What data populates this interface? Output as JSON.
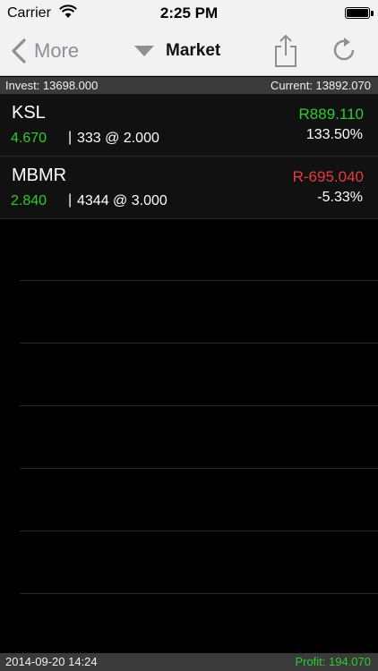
{
  "status_bar": {
    "carrier": "Carrier",
    "time": "2:25 PM",
    "wifi_icon": "wifi-icon",
    "battery_icon": "battery-icon"
  },
  "nav": {
    "back_label": "More",
    "back_icon": "chevron-left-icon",
    "market_label": "Market",
    "market_icon": "triangle-down-icon",
    "share_icon": "share-icon",
    "refresh_icon": "refresh-icon"
  },
  "summary": {
    "invest": "Invest: 13698.000",
    "current": "Current: 13892.070"
  },
  "holdings": [
    {
      "symbol": "KSL",
      "price": "4.670",
      "separator": "|",
      "quantity": "333 @ 2.000",
      "pl": "R889.110",
      "pl_color": "#2ecc2e",
      "percent": "133.50%"
    },
    {
      "symbol": "MBMR",
      "price": "2.840",
      "separator": "|",
      "quantity": "4344 @ 3.000",
      "pl": "R-695.040",
      "pl_color": "#e63c3c",
      "percent": "-5.33%"
    }
  ],
  "footer": {
    "datetime": "2014-09-20 14:24",
    "profit": "Profit: 194.070"
  },
  "colors": {
    "gain": "#2ecc2e",
    "loss": "#e63c3c",
    "bar_background": "#f2f2f3",
    "strip_background": "#3a3a3a"
  }
}
